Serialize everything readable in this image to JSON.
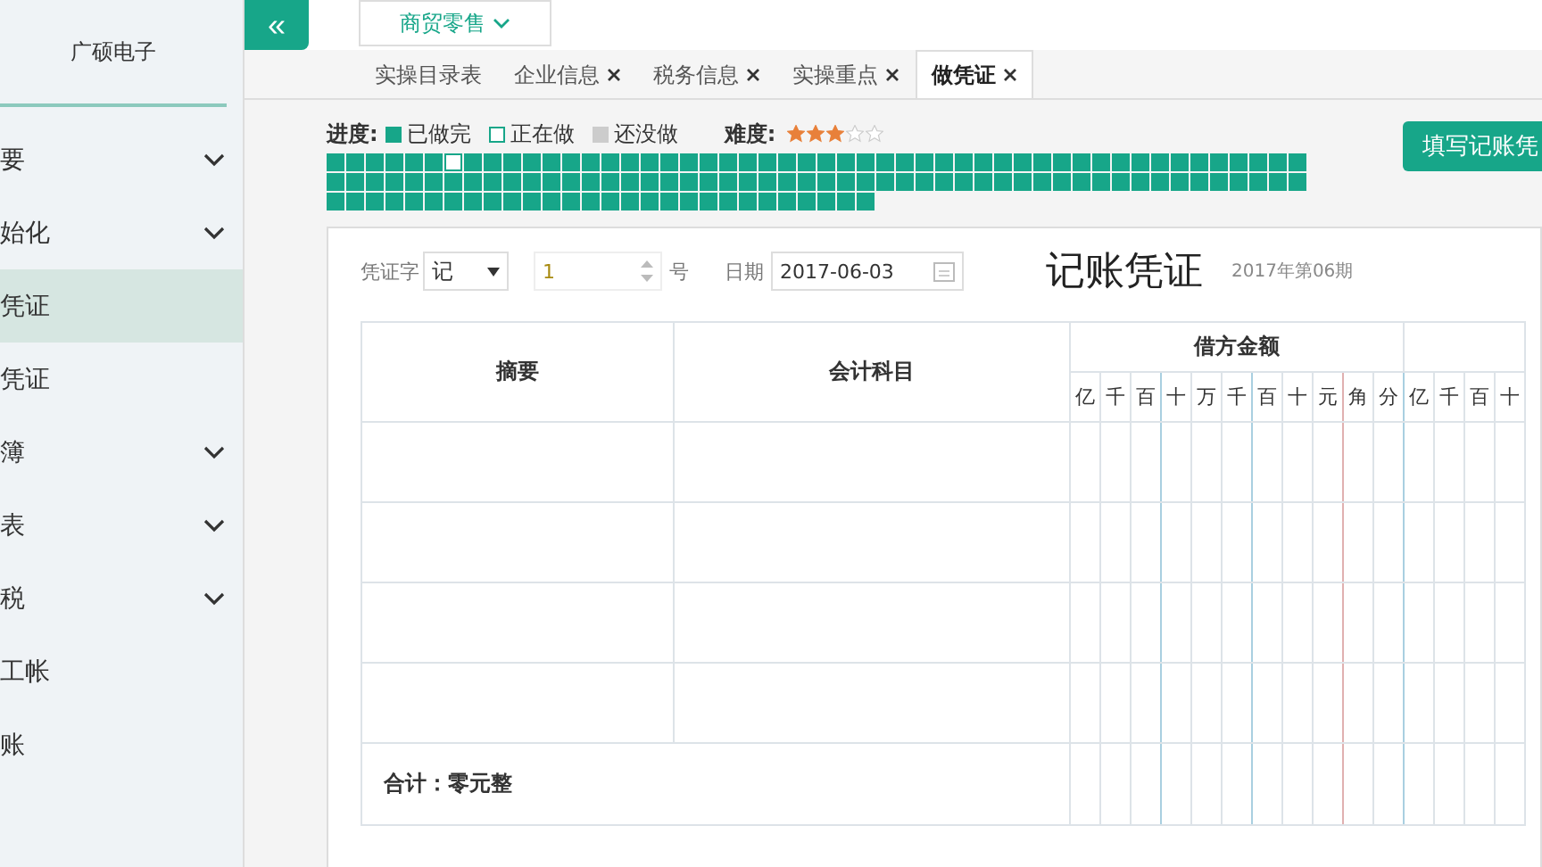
{
  "sidebar": {
    "company": "广硕电子",
    "items": [
      {
        "label": "要",
        "kind": "group",
        "selected": false
      },
      {
        "label": "始化",
        "kind": "group",
        "selected": false
      },
      {
        "label": "凭证",
        "kind": "link",
        "selected": true
      },
      {
        "label": "凭证",
        "kind": "link",
        "selected": false
      },
      {
        "label": "簿",
        "kind": "group",
        "selected": false
      },
      {
        "label": "表",
        "kind": "group",
        "selected": false
      },
      {
        "label": "税",
        "kind": "group",
        "selected": false
      },
      {
        "label": "工帐",
        "kind": "link",
        "selected": false
      },
      {
        "label": "账",
        "kind": "link",
        "selected": false
      }
    ]
  },
  "topbar": {
    "collapse": "«",
    "industry": "商贸零售"
  },
  "tabs": [
    {
      "label": "实操目录表",
      "closable": false,
      "selected": false
    },
    {
      "label": "企业信息",
      "closable": true,
      "selected": false
    },
    {
      "label": "税务信息",
      "closable": true,
      "selected": false
    },
    {
      "label": "实操重点",
      "closable": true,
      "selected": false
    },
    {
      "label": "做凭证",
      "closable": true,
      "selected": true
    }
  ],
  "progress": {
    "label": "进度:",
    "legend": [
      {
        "kind": "done",
        "label": "已做完"
      },
      {
        "kind": "current",
        "label": "正在做"
      },
      {
        "kind": "todo",
        "label": "还没做"
      }
    ],
    "difficulty_label": "难度:",
    "stars": 3,
    "cells": [
      {
        "kind": "done"
      },
      {
        "kind": "done"
      },
      {
        "kind": "done"
      },
      {
        "kind": "done"
      },
      {
        "kind": "done"
      },
      {
        "kind": "done"
      },
      {
        "kind": "current"
      },
      {
        "kind": "done"
      },
      {
        "kind": "done"
      },
      {
        "kind": "done"
      },
      {
        "kind": "done"
      },
      {
        "kind": "done"
      },
      {
        "kind": "done"
      },
      {
        "kind": "done"
      },
      {
        "kind": "done"
      },
      {
        "kind": "done"
      },
      {
        "kind": "done"
      },
      {
        "kind": "done"
      },
      {
        "kind": "done"
      },
      {
        "kind": "done"
      },
      {
        "kind": "done"
      },
      {
        "kind": "done"
      },
      {
        "kind": "done"
      },
      {
        "kind": "done"
      },
      {
        "kind": "done"
      },
      {
        "kind": "done"
      },
      {
        "kind": "done"
      },
      {
        "kind": "done"
      },
      {
        "kind": "done"
      },
      {
        "kind": "done"
      },
      {
        "kind": "done"
      },
      {
        "kind": "done"
      },
      {
        "kind": "done"
      },
      {
        "kind": "done"
      },
      {
        "kind": "done"
      },
      {
        "kind": "done"
      },
      {
        "kind": "done"
      },
      {
        "kind": "done"
      },
      {
        "kind": "done"
      },
      {
        "kind": "done"
      },
      {
        "kind": "done"
      },
      {
        "kind": "done"
      },
      {
        "kind": "done"
      },
      {
        "kind": "done"
      },
      {
        "kind": "done"
      },
      {
        "kind": "done"
      },
      {
        "kind": "done"
      },
      {
        "kind": "done"
      },
      {
        "kind": "done"
      },
      {
        "kind": "done"
      },
      {
        "kind": "done"
      },
      {
        "kind": "done"
      },
      {
        "kind": "done"
      },
      {
        "kind": "done"
      },
      {
        "kind": "done"
      },
      {
        "kind": "done"
      },
      {
        "kind": "done"
      },
      {
        "kind": "done"
      },
      {
        "kind": "done"
      },
      {
        "kind": "done"
      },
      {
        "kind": "done"
      },
      {
        "kind": "done"
      },
      {
        "kind": "done"
      },
      {
        "kind": "done"
      },
      {
        "kind": "done"
      },
      {
        "kind": "done"
      },
      {
        "kind": "done"
      },
      {
        "kind": "done"
      },
      {
        "kind": "done"
      },
      {
        "kind": "done"
      },
      {
        "kind": "done"
      },
      {
        "kind": "done"
      },
      {
        "kind": "done"
      },
      {
        "kind": "done"
      },
      {
        "kind": "done"
      },
      {
        "kind": "done"
      },
      {
        "kind": "done"
      },
      {
        "kind": "done"
      },
      {
        "kind": "done"
      },
      {
        "kind": "done"
      },
      {
        "kind": "done"
      },
      {
        "kind": "done"
      },
      {
        "kind": "done"
      },
      {
        "kind": "done"
      },
      {
        "kind": "done"
      },
      {
        "kind": "done"
      },
      {
        "kind": "done"
      },
      {
        "kind": "done"
      },
      {
        "kind": "done"
      },
      {
        "kind": "done"
      },
      {
        "kind": "done"
      },
      {
        "kind": "done"
      },
      {
        "kind": "done"
      },
      {
        "kind": "done"
      },
      {
        "kind": "done"
      },
      {
        "kind": "done"
      },
      {
        "kind": "done"
      },
      {
        "kind": "done"
      },
      {
        "kind": "done"
      },
      {
        "kind": "done"
      },
      {
        "kind": "done"
      },
      {
        "kind": "done"
      },
      {
        "kind": "done"
      },
      {
        "kind": "done"
      },
      {
        "kind": "done"
      },
      {
        "kind": "done"
      },
      {
        "kind": "done"
      },
      {
        "kind": "done"
      },
      {
        "kind": "done"
      },
      {
        "kind": "done"
      },
      {
        "kind": "done"
      },
      {
        "kind": "done"
      },
      {
        "kind": "done"
      },
      {
        "kind": "done"
      },
      {
        "kind": "done"
      },
      {
        "kind": "done"
      },
      {
        "kind": "done"
      },
      {
        "kind": "done"
      },
      {
        "kind": "done"
      },
      {
        "kind": "done"
      },
      {
        "kind": "done"
      },
      {
        "kind": "done"
      },
      {
        "kind": "done"
      },
      {
        "kind": "done"
      },
      {
        "kind": "done"
      },
      {
        "kind": "done"
      },
      {
        "kind": "done"
      },
      {
        "kind": "done"
      }
    ]
  },
  "action_button": "填写记账凭",
  "voucher": {
    "type_label": "凭证字",
    "type_value": "记",
    "number_value": "1",
    "number_suffix": "号",
    "date_label": "日期",
    "date_value": "2017-06-03",
    "title": "记账凭证",
    "period": "2017年第06期",
    "columns": {
      "summary": "摘要",
      "account": "会计科目",
      "debit": "借方金额",
      "debit_units": [
        "亿",
        "千",
        "百",
        "十",
        "万",
        "千",
        "百",
        "十",
        "元",
        "角",
        "分"
      ],
      "credit_units": [
        "亿",
        "千",
        "百",
        "十"
      ]
    },
    "total": "合计：零元整"
  }
}
